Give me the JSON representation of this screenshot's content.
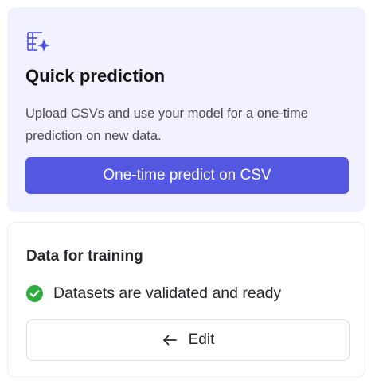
{
  "quick_prediction": {
    "icon": "table-sparkle-icon",
    "title": "Quick prediction",
    "description": "Upload CSVs and use your model for a one-time prediction on new data.",
    "button_label": "One-time predict on CSV"
  },
  "data_for_training": {
    "title": "Data for training",
    "status_icon": "check-circle-icon",
    "status_text": "Datasets are validated and ready",
    "edit_icon": "arrow-left-icon",
    "edit_label": "Edit"
  },
  "colors": {
    "accent": "#5457e0",
    "quick_card_bg": "#f1f2fd",
    "success": "#2fae3f"
  }
}
